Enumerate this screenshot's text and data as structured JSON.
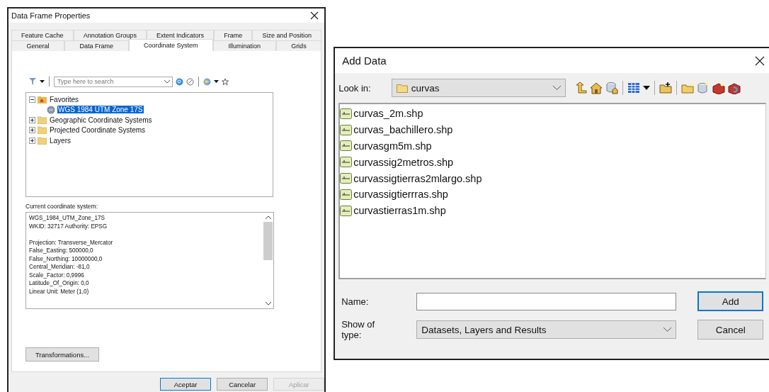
{
  "data_frame_properties": {
    "title": "Data Frame Properties",
    "tab_rows": [
      [
        {
          "label": "Feature Cache",
          "selected": false
        },
        {
          "label": "Annotation Groups",
          "selected": false
        },
        {
          "label": "Extent Indicators",
          "selected": false
        },
        {
          "label": "Frame",
          "selected": false
        },
        {
          "label": "Size and Position",
          "selected": false
        }
      ],
      [
        {
          "label": "General",
          "selected": false
        },
        {
          "label": "Data Frame",
          "selected": false
        },
        {
          "label": "Coordinate System",
          "selected": true
        },
        {
          "label": "Illumination",
          "selected": false
        },
        {
          "label": "Grids",
          "selected": false
        }
      ]
    ],
    "search": {
      "placeholder": "Type here to search"
    },
    "tree": [
      {
        "kind": "favorites",
        "label": "Favorites",
        "expanded": true,
        "selected": false,
        "children": [
          {
            "kind": "system",
            "label": "WGS 1984 UTM Zone 17S",
            "selected": true
          }
        ]
      },
      {
        "kind": "folder",
        "label": "Geographic Coordinate Systems",
        "expanded": false,
        "selected": false
      },
      {
        "kind": "folder",
        "label": "Projected Coordinate Systems",
        "expanded": false,
        "selected": false
      },
      {
        "kind": "folder",
        "label": "Layers",
        "expanded": false,
        "selected": false
      }
    ],
    "current_label": "Current coordinate system:",
    "current_system": [
      [
        "WGS_1984_UTM_Zone_17S",
        "WKID: 32717 Authority: EPSG"
      ],
      [
        "Projection: Transverse_Mercator",
        "False_Easting: 500000,0",
        "False_Northing: 10000000,0",
        "Central_Meridian: -81,0",
        "Scale_Factor: 0,9996",
        "Latitude_Of_Origin: 0,0",
        "Linear Unit: Meter (1,0)"
      ]
    ],
    "transformations_button": "Transformations...",
    "buttons": [
      {
        "label": "Aceptar",
        "default": true,
        "disabled": false
      },
      {
        "label": "Cancelar",
        "default": false,
        "disabled": false
      },
      {
        "label": "Aplicar",
        "default": false,
        "disabled": true
      }
    ]
  },
  "add_data": {
    "title": "Add Data",
    "look_in_label": "Look in:",
    "look_in_value": "curvas",
    "files": [
      "curvas_2m.shp",
      "curvas_bachillero.shp",
      "curvasgm5m.shp",
      "curvassig2metros.shp",
      "curvassigtierras2mlargo.shp",
      "curvassigtierrras.shp",
      "curvastierras1m.shp"
    ],
    "name_label": "Name:",
    "show_type_label": "Show of type:",
    "show_type_value": "Datasets, Layers and Results",
    "buttons": [
      {
        "label": "Add",
        "default": true,
        "disabled": false
      },
      {
        "label": "Cancel",
        "default": false,
        "disabled": false
      }
    ]
  }
}
